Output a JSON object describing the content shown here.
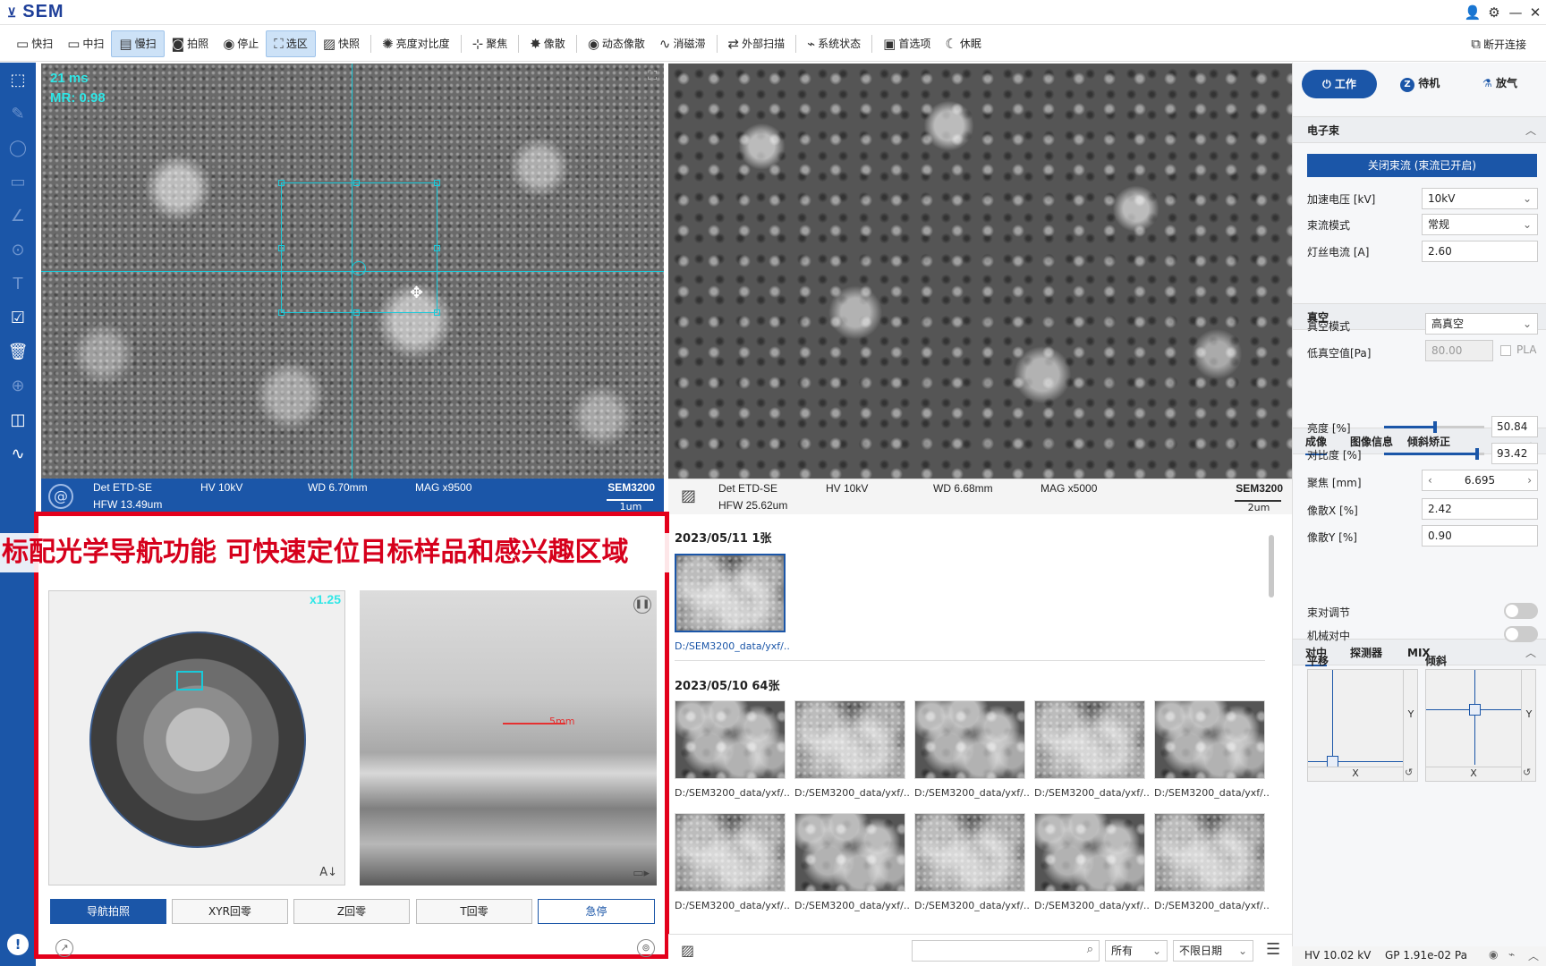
{
  "app": {
    "name": "SEM"
  },
  "toolbar": {
    "items": [
      {
        "icon": "scan-fast-icon",
        "label": "快扫"
      },
      {
        "icon": "scan-mid-icon",
        "label": "中扫"
      },
      {
        "icon": "scan-slow-icon",
        "label": "慢扫"
      },
      {
        "icon": "camera-icon",
        "label": "拍照"
      },
      {
        "icon": "stop-icon",
        "label": "停止"
      },
      {
        "icon": "select-region-icon",
        "label": "选区"
      },
      {
        "icon": "snapshot-icon",
        "label": "快照"
      },
      {
        "icon": "brightness-contrast-icon",
        "label": "亮度对比度"
      },
      {
        "icon": "focus-icon",
        "label": "聚焦"
      },
      {
        "icon": "astigmatism-icon",
        "label": "像散"
      },
      {
        "icon": "dynamic-astig-icon",
        "label": "动态像散"
      },
      {
        "icon": "degauss-icon",
        "label": "消磁滞"
      },
      {
        "icon": "external-scan-icon",
        "label": "外部扫描"
      },
      {
        "icon": "system-status-icon",
        "label": "系统状态"
      },
      {
        "icon": "preferences-icon",
        "label": "首选项"
      },
      {
        "icon": "sleep-icon",
        "label": "休眠"
      }
    ],
    "disconnect": "断开连接"
  },
  "live_pane": {
    "overlay_time": "21 ms",
    "overlay_mr": "MR: 0.98",
    "info": {
      "det": "Det ETD-SE",
      "hv": "HV 10kV",
      "wd": "WD 6.70mm",
      "mag": "MAG  x9500",
      "model": "SEM3200",
      "hfw": "HFW 13.49um",
      "scale": "1um"
    }
  },
  "ref_pane": {
    "info": {
      "det": "Det ETD-SE",
      "hv": "HV 10kV",
      "wd": "WD 6.68mm",
      "mag": "MAG  x5000",
      "model": "SEM3200",
      "hfw": "HFW 25.62um",
      "scale": "2um"
    }
  },
  "nav": {
    "banner": "标配光学导航功能 可快速定位目标样品和感兴趣区域",
    "zoom": "x1.25",
    "mm_label": "5mm",
    "buttons": {
      "nav_photo": "导航拍照",
      "xyr_home": "XYR回零",
      "z_home": "Z回零",
      "t_home": "T回零",
      "estop": "急停"
    }
  },
  "gallery": {
    "group1": {
      "date": "2023/05/11 1张",
      "items": [
        "D:/SEM3200_data/yxf/..."
      ]
    },
    "group2": {
      "date": "2023/05/10 64张",
      "items": [
        "D:/SEM3200_data/yxf/...",
        "D:/SEM3200_data/yxf/...",
        "D:/SEM3200_data/yxf/...",
        "D:/SEM3200_data/yxf/...",
        "D:/SEM3200_data/yxf/...",
        "D:/SEM3200_data/yxf/...",
        "D:/SEM3200_data/yxf/...",
        "D:/SEM3200_data/yxf/...",
        "D:/SEM3200_data/yxf/...",
        "D:/SEM3200_data/yxf/..."
      ]
    },
    "filter_all": "所有",
    "filter_date": "不限日期"
  },
  "right": {
    "modes": {
      "work": "工作",
      "standby": "待机",
      "vent": "放气"
    },
    "beam": {
      "title": "电子束",
      "close_btn": "关闭束流 (束流已开启)",
      "hv_label": "加速电压 [kV]",
      "hv_value": "10kV",
      "mode_label": "束流模式",
      "mode_value": "常规",
      "fil_label": "灯丝电流 [A]",
      "fil_value": "2.60"
    },
    "vacuum": {
      "title": "真空",
      "mode_label": "真空模式",
      "mode_value": "高真空",
      "low_label": "低真空值[Pa]",
      "low_value": "80.00",
      "pla": "PLA"
    },
    "imaging": {
      "tabs": [
        "成像",
        "图像信息",
        "倾斜矫正"
      ],
      "brightness_label": "亮度 [%]",
      "brightness_value": "50.84",
      "brightness_level": 0.51,
      "contrast_label": "对比度 [%]",
      "contrast_value": "93.42",
      "contrast_level": 0.93,
      "focus_label": "聚焦 [mm]",
      "focus_value": "6.695",
      "astx_label": "像散X [%]",
      "astx_value": "2.42",
      "asty_label": "像散Y [%]",
      "asty_value": "0.90"
    },
    "align": {
      "tabs": [
        "对中",
        "探测器",
        "MIX"
      ],
      "beam_adj": "束对调节",
      "mech_align": "机械对中",
      "shift": "平移",
      "tilt": "倾斜",
      "x": "X",
      "y": "Y"
    }
  },
  "status": {
    "hv": "HV 10.02 kV",
    "gp": "GP 1.91e-02 Pa"
  }
}
